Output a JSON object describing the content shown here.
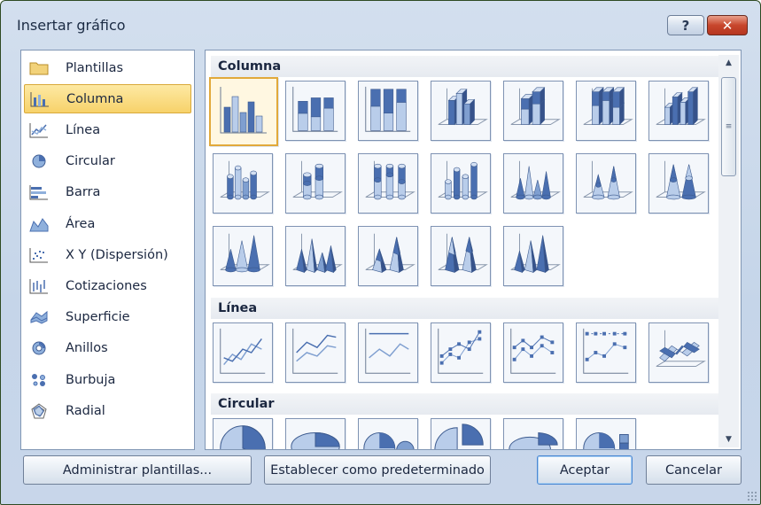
{
  "window": {
    "title": "Insertar gráfico",
    "help_label": "?",
    "close_label": "✕"
  },
  "categories": [
    {
      "label": "Plantillas",
      "icon": "folder-icon"
    },
    {
      "label": "Columna",
      "icon": "column-chart-icon",
      "selected": true
    },
    {
      "label": "Línea",
      "icon": "line-chart-icon"
    },
    {
      "label": "Circular",
      "icon": "pie-chart-icon"
    },
    {
      "label": "Barra",
      "icon": "bar-chart-icon"
    },
    {
      "label": "Área",
      "icon": "area-chart-icon"
    },
    {
      "label": "X Y (Dispersión)",
      "icon": "scatter-chart-icon"
    },
    {
      "label": "Cotizaciones",
      "icon": "stock-chart-icon"
    },
    {
      "label": "Superficie",
      "icon": "surface-chart-icon"
    },
    {
      "label": "Anillos",
      "icon": "doughnut-chart-icon"
    },
    {
      "label": "Burbuja",
      "icon": "bubble-chart-icon"
    },
    {
      "label": "Radial",
      "icon": "radar-chart-icon"
    }
  ],
  "sections": [
    {
      "title": "Columna",
      "thumbnails": [
        {
          "style": "clustered-column",
          "selected": true
        },
        {
          "style": "stacked-column"
        },
        {
          "style": "100-stacked-column"
        },
        {
          "style": "3d-clustered-column"
        },
        {
          "style": "3d-stacked-column"
        },
        {
          "style": "3d-100-stacked-column"
        },
        {
          "style": "3d-column"
        },
        {
          "style": "clustered-cylinder"
        },
        {
          "style": "stacked-cylinder"
        },
        {
          "style": "100-stacked-cylinder"
        },
        {
          "style": "3d-cylinder"
        },
        {
          "style": "clustered-cone"
        },
        {
          "style": "stacked-cone"
        },
        {
          "style": "100-stacked-cone"
        },
        {
          "style": "3d-cone"
        },
        {
          "style": "clustered-pyramid"
        },
        {
          "style": "stacked-pyramid"
        },
        {
          "style": "100-stacked-pyramid"
        },
        {
          "style": "3d-pyramid"
        }
      ]
    },
    {
      "title": "Línea",
      "thumbnails": [
        {
          "style": "line"
        },
        {
          "style": "stacked-line"
        },
        {
          "style": "100-stacked-line"
        },
        {
          "style": "line-markers"
        },
        {
          "style": "stacked-line-markers"
        },
        {
          "style": "100-stacked-line-markers"
        },
        {
          "style": "3d-line"
        }
      ]
    },
    {
      "title": "Circular",
      "thumbnails": [
        {
          "style": "pie"
        },
        {
          "style": "3d-pie"
        },
        {
          "style": "pie-of-pie"
        },
        {
          "style": "exploded-pie"
        },
        {
          "style": "3d-exploded-pie"
        },
        {
          "style": "bar-of-pie"
        }
      ]
    }
  ],
  "buttons": {
    "manage_templates": "Administrar plantillas...",
    "set_default": "Establecer como predeterminado",
    "ok": "Aceptar",
    "cancel": "Cancelar"
  },
  "colors": {
    "accent": "#4a6fb0",
    "selection": "#f7d26a",
    "frame": "#c5d5e9"
  }
}
